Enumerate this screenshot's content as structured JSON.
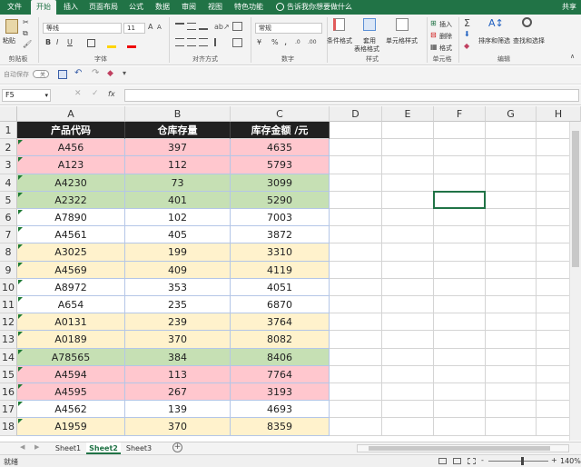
{
  "ribbon_tabs": [
    "文件",
    "开始",
    "插入",
    "页面布局",
    "公式",
    "数据",
    "审阅",
    "视图",
    "特色功能"
  ],
  "active_tab_index": 1,
  "tell_me": "告诉我你想要做什么",
  "share": "共享",
  "clipboard": {
    "paste": "粘贴",
    "group": "剪贴板"
  },
  "font": {
    "name": "等线",
    "size": "11",
    "group": "字体",
    "bold": "B",
    "italic": "I",
    "underline": "U",
    "grow": "A",
    "shrink": "A"
  },
  "alignment": {
    "group": "对齐方式"
  },
  "number": {
    "format": "常规",
    "group": "数字",
    "percent": "%",
    "comma": ","
  },
  "styles": {
    "conditional": "条件格式",
    "table_line1": "套用",
    "table_line2": "表格格式",
    "cell_styles": "单元格样式",
    "group": "样式"
  },
  "cells": {
    "insert": "插入",
    "delete": "删除",
    "format": "格式",
    "group": "单元格"
  },
  "editing": {
    "sort": "排序和筛选",
    "find": "查找和选择",
    "group": "编辑"
  },
  "qat": {
    "autosave": "自动保存",
    "toggle": "关"
  },
  "formula_bar": {
    "name_box": "F5",
    "fx": "fx",
    "content": ""
  },
  "columns": [
    "A",
    "B",
    "C",
    "D",
    "E",
    "F",
    "G",
    "H"
  ],
  "table": {
    "headers": [
      "产品代码",
      "仓库存量",
      "库存金额 /元"
    ],
    "rows": [
      {
        "row": "2",
        "code": "A456",
        "qty": "397",
        "amount": "4635",
        "fill": "#ffc7ce"
      },
      {
        "row": "3",
        "code": "A123",
        "qty": "112",
        "amount": "5793",
        "fill": "#ffc7ce"
      },
      {
        "row": "4",
        "code": "A4230",
        "qty": "73",
        "amount": "3099",
        "fill": "#c6e0b4"
      },
      {
        "row": "5",
        "code": "A2322",
        "qty": "401",
        "amount": "5290",
        "fill": "#c6e0b4"
      },
      {
        "row": "6",
        "code": "A7890",
        "qty": "102",
        "amount": "7003",
        "fill": "#ffffff"
      },
      {
        "row": "7",
        "code": "A4561",
        "qty": "405",
        "amount": "3872",
        "fill": "#ffffff"
      },
      {
        "row": "8",
        "code": "A3025",
        "qty": "199",
        "amount": "3310",
        "fill": "#fff2cc"
      },
      {
        "row": "9",
        "code": "A4569",
        "qty": "409",
        "amount": "4119",
        "fill": "#fff2cc"
      },
      {
        "row": "10",
        "code": "A8972",
        "qty": "353",
        "amount": "4051",
        "fill": "#ffffff"
      },
      {
        "row": "11",
        "code": "A654",
        "qty": "235",
        "amount": "6870",
        "fill": "#ffffff"
      },
      {
        "row": "12",
        "code": "A0131",
        "qty": "239",
        "amount": "3764",
        "fill": "#fff2cc"
      },
      {
        "row": "13",
        "code": "A0189",
        "qty": "370",
        "amount": "8082",
        "fill": "#fff2cc"
      },
      {
        "row": "14",
        "code": "A78565",
        "qty": "384",
        "amount": "8406",
        "fill": "#c6e0b4"
      },
      {
        "row": "15",
        "code": "A4594",
        "qty": "113",
        "amount": "7764",
        "fill": "#ffc7ce"
      },
      {
        "row": "16",
        "code": "A4595",
        "qty": "267",
        "amount": "3193",
        "fill": "#ffc7ce"
      },
      {
        "row": "17",
        "code": "A4562",
        "qty": "139",
        "amount": "4693",
        "fill": "#ffffff"
      },
      {
        "row": "18",
        "code": "A1959",
        "qty": "370",
        "amount": "8359",
        "fill": "#fff2cc"
      }
    ]
  },
  "sheets": [
    "Sheet1",
    "Sheet2",
    "Sheet3"
  ],
  "active_sheet_index": 1,
  "status": {
    "ready": "就绪",
    "zoom": "140%",
    "zoom_minus": "-",
    "zoom_plus": "+"
  },
  "colors": {
    "accent": "#217346",
    "header_fill": "#202020",
    "red_fill": "#ffc7ce",
    "green_fill": "#c6e0b4",
    "yellow_fill": "#fff2cc"
  }
}
